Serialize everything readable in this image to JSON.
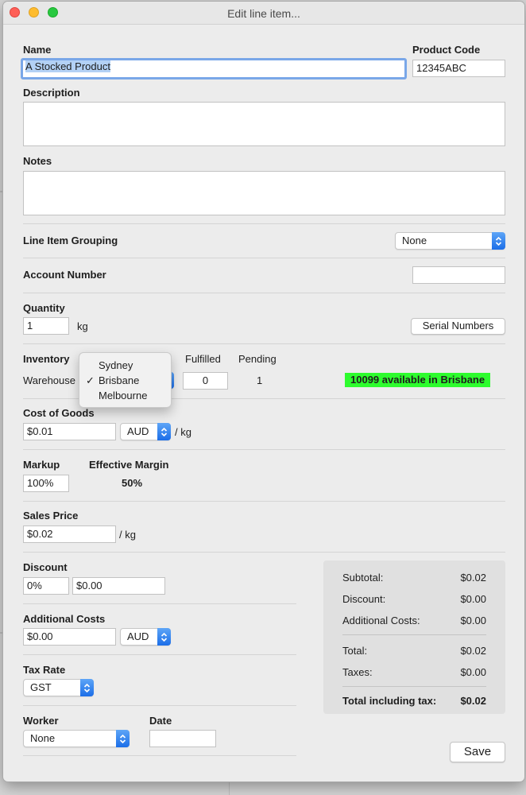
{
  "window": {
    "title": "Edit line item..."
  },
  "name": {
    "label": "Name",
    "value": "A Stocked Product"
  },
  "product_code": {
    "label": "Product Code",
    "value": "12345ABC"
  },
  "description": {
    "label": "Description",
    "value": ""
  },
  "notes": {
    "label": "Notes",
    "value": ""
  },
  "grouping": {
    "label": "Line Item Grouping",
    "value": "None"
  },
  "account_number": {
    "label": "Account Number",
    "value": ""
  },
  "quantity": {
    "label": "Quantity",
    "value": "1",
    "unit": "kg",
    "serial_button": "Serial Numbers"
  },
  "inventory": {
    "label": "Inventory",
    "warehouse_label": "Warehouse",
    "fulfilled_label": "Fulfilled",
    "fulfilled_value": "0",
    "pending_label": "Pending",
    "pending_value": "1",
    "availability": "10099 available in Brisbane",
    "availability_color": "#2efc2e",
    "warehouse_options": [
      "Sydney",
      "Brisbane",
      "Melbourne"
    ],
    "selected_warehouse": "Brisbane",
    "check_mark": "✓"
  },
  "cost_of_goods": {
    "label": "Cost of Goods",
    "value": "$0.01",
    "currency": "AUD",
    "unit": "/ kg"
  },
  "markup": {
    "label": "Markup",
    "value": "100%",
    "margin_label": "Effective Margin",
    "margin_value": "50%"
  },
  "sales_price": {
    "label": "Sales Price",
    "value": "$0.02",
    "unit": "/ kg"
  },
  "discount": {
    "label": "Discount",
    "percent": "0%",
    "amount": "$0.00"
  },
  "additional_costs": {
    "label": "Additional Costs",
    "value": "$0.00",
    "currency": "AUD"
  },
  "tax_rate": {
    "label": "Tax Rate",
    "value": "GST"
  },
  "worker": {
    "label": "Worker",
    "value": "None"
  },
  "date": {
    "label": "Date",
    "value": ""
  },
  "summary": {
    "subtotal_label": "Subtotal:",
    "subtotal": "$0.02",
    "discount_label": "Discount:",
    "discount": "$0.00",
    "additional_label": "Additional Costs:",
    "additional": "$0.00",
    "total_label": "Total:",
    "total": "$0.02",
    "taxes_label": "Taxes:",
    "taxes": "$0.00",
    "grand_label": "Total including tax:",
    "grand": "$0.02"
  },
  "save_button": "Save",
  "colors": {
    "accent": "#1b6ee8",
    "focus_ring": "#7aa7e8"
  }
}
